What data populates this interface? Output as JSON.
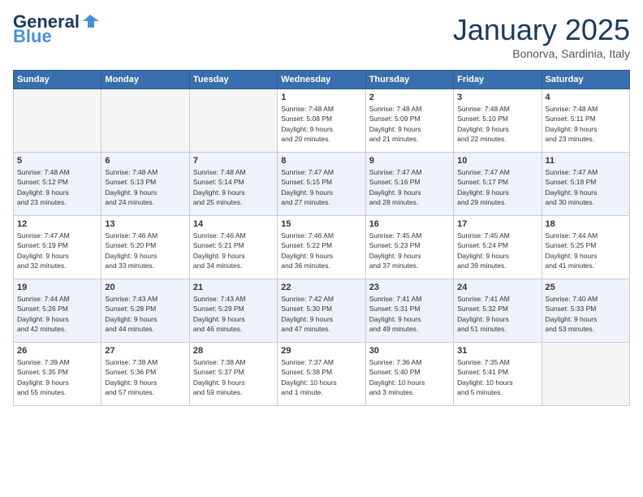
{
  "header": {
    "logo_line1": "General",
    "logo_line2": "Blue",
    "month": "January 2025",
    "location": "Bonorva, Sardinia, Italy"
  },
  "weekdays": [
    "Sunday",
    "Monday",
    "Tuesday",
    "Wednesday",
    "Thursday",
    "Friday",
    "Saturday"
  ],
  "weeks": [
    [
      {
        "day": "",
        "info": ""
      },
      {
        "day": "",
        "info": ""
      },
      {
        "day": "",
        "info": ""
      },
      {
        "day": "1",
        "info": "Sunrise: 7:48 AM\nSunset: 5:08 PM\nDaylight: 9 hours\nand 20 minutes."
      },
      {
        "day": "2",
        "info": "Sunrise: 7:48 AM\nSunset: 5:09 PM\nDaylight: 9 hours\nand 21 minutes."
      },
      {
        "day": "3",
        "info": "Sunrise: 7:48 AM\nSunset: 5:10 PM\nDaylight: 9 hours\nand 22 minutes."
      },
      {
        "day": "4",
        "info": "Sunrise: 7:48 AM\nSunset: 5:11 PM\nDaylight: 9 hours\nand 23 minutes."
      }
    ],
    [
      {
        "day": "5",
        "info": "Sunrise: 7:48 AM\nSunset: 5:12 PM\nDaylight: 9 hours\nand 23 minutes."
      },
      {
        "day": "6",
        "info": "Sunrise: 7:48 AM\nSunset: 5:13 PM\nDaylight: 9 hours\nand 24 minutes."
      },
      {
        "day": "7",
        "info": "Sunrise: 7:48 AM\nSunset: 5:14 PM\nDaylight: 9 hours\nand 25 minutes."
      },
      {
        "day": "8",
        "info": "Sunrise: 7:47 AM\nSunset: 5:15 PM\nDaylight: 9 hours\nand 27 minutes."
      },
      {
        "day": "9",
        "info": "Sunrise: 7:47 AM\nSunset: 5:16 PM\nDaylight: 9 hours\nand 28 minutes."
      },
      {
        "day": "10",
        "info": "Sunrise: 7:47 AM\nSunset: 5:17 PM\nDaylight: 9 hours\nand 29 minutes."
      },
      {
        "day": "11",
        "info": "Sunrise: 7:47 AM\nSunset: 5:18 PM\nDaylight: 9 hours\nand 30 minutes."
      }
    ],
    [
      {
        "day": "12",
        "info": "Sunrise: 7:47 AM\nSunset: 5:19 PM\nDaylight: 9 hours\nand 32 minutes."
      },
      {
        "day": "13",
        "info": "Sunrise: 7:46 AM\nSunset: 5:20 PM\nDaylight: 9 hours\nand 33 minutes."
      },
      {
        "day": "14",
        "info": "Sunrise: 7:46 AM\nSunset: 5:21 PM\nDaylight: 9 hours\nand 34 minutes."
      },
      {
        "day": "15",
        "info": "Sunrise: 7:46 AM\nSunset: 5:22 PM\nDaylight: 9 hours\nand 36 minutes."
      },
      {
        "day": "16",
        "info": "Sunrise: 7:45 AM\nSunset: 5:23 PM\nDaylight: 9 hours\nand 37 minutes."
      },
      {
        "day": "17",
        "info": "Sunrise: 7:45 AM\nSunset: 5:24 PM\nDaylight: 9 hours\nand 39 minutes."
      },
      {
        "day": "18",
        "info": "Sunrise: 7:44 AM\nSunset: 5:25 PM\nDaylight: 9 hours\nand 41 minutes."
      }
    ],
    [
      {
        "day": "19",
        "info": "Sunrise: 7:44 AM\nSunset: 5:26 PM\nDaylight: 9 hours\nand 42 minutes."
      },
      {
        "day": "20",
        "info": "Sunrise: 7:43 AM\nSunset: 5:28 PM\nDaylight: 9 hours\nand 44 minutes."
      },
      {
        "day": "21",
        "info": "Sunrise: 7:43 AM\nSunset: 5:29 PM\nDaylight: 9 hours\nand 46 minutes."
      },
      {
        "day": "22",
        "info": "Sunrise: 7:42 AM\nSunset: 5:30 PM\nDaylight: 9 hours\nand 47 minutes."
      },
      {
        "day": "23",
        "info": "Sunrise: 7:41 AM\nSunset: 5:31 PM\nDaylight: 9 hours\nand 49 minutes."
      },
      {
        "day": "24",
        "info": "Sunrise: 7:41 AM\nSunset: 5:32 PM\nDaylight: 9 hours\nand 51 minutes."
      },
      {
        "day": "25",
        "info": "Sunrise: 7:40 AM\nSunset: 5:33 PM\nDaylight: 9 hours\nand 53 minutes."
      }
    ],
    [
      {
        "day": "26",
        "info": "Sunrise: 7:39 AM\nSunset: 5:35 PM\nDaylight: 9 hours\nand 55 minutes."
      },
      {
        "day": "27",
        "info": "Sunrise: 7:38 AM\nSunset: 5:36 PM\nDaylight: 9 hours\nand 57 minutes."
      },
      {
        "day": "28",
        "info": "Sunrise: 7:38 AM\nSunset: 5:37 PM\nDaylight: 9 hours\nand 59 minutes."
      },
      {
        "day": "29",
        "info": "Sunrise: 7:37 AM\nSunset: 5:38 PM\nDaylight: 10 hours\nand 1 minute."
      },
      {
        "day": "30",
        "info": "Sunrise: 7:36 AM\nSunset: 5:40 PM\nDaylight: 10 hours\nand 3 minutes."
      },
      {
        "day": "31",
        "info": "Sunrise: 7:35 AM\nSunset: 5:41 PM\nDaylight: 10 hours\nand 5 minutes."
      },
      {
        "day": "",
        "info": ""
      }
    ]
  ]
}
